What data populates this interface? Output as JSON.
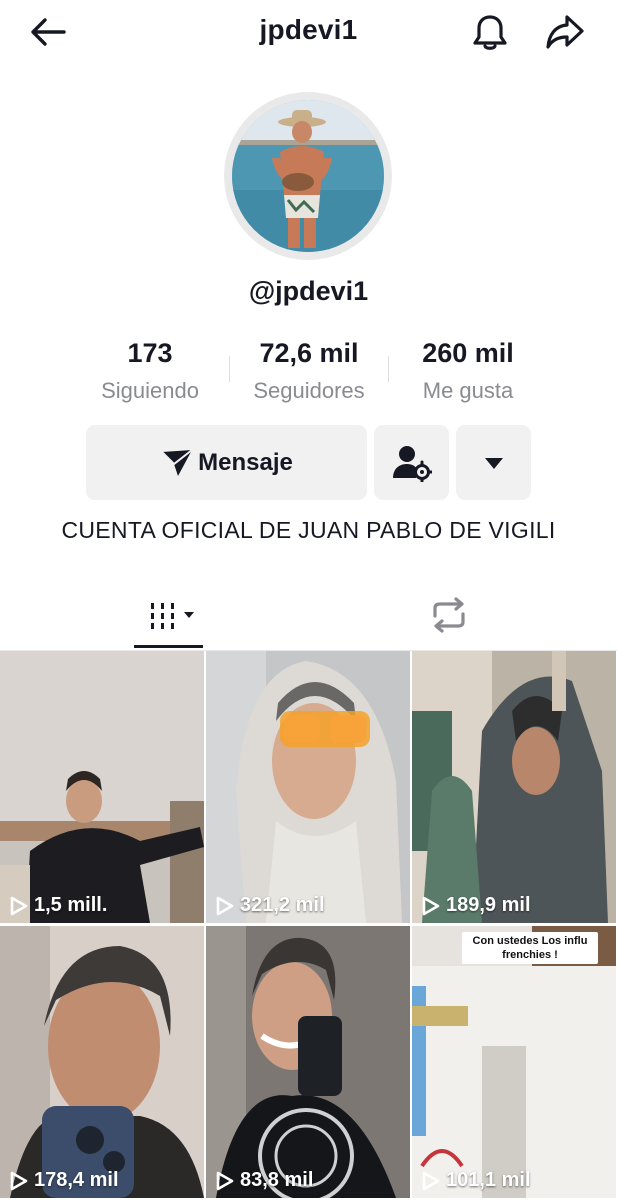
{
  "header": {
    "title": "jpdevi1",
    "back_icon": "arrow-left-icon",
    "bell_icon": "bell-icon",
    "share_icon": "share-arrow-icon"
  },
  "profile": {
    "handle": "@jpdevi1",
    "avatar_icon": "profile-photo",
    "stats": [
      {
        "value": "173",
        "label": "Siguiendo"
      },
      {
        "value": "72,6 mil",
        "label": "Seguidores"
      },
      {
        "value": "260 mil",
        "label": "Me gusta"
      }
    ],
    "message_button": {
      "label": "Mensaje",
      "icon": "send-icon"
    },
    "add_friend_icon": "user-settings-icon",
    "more_icon": "caret-down-icon",
    "bio": "CUENTA OFICIAL DE JUAN PABLO DE VIGILI"
  },
  "tabs": [
    {
      "name": "videos",
      "icon": "grid-lines-icon",
      "active": true
    },
    {
      "name": "reposts",
      "icon": "repost-icon",
      "active": false
    }
  ],
  "videos": [
    {
      "views": "1,5 mill."
    },
    {
      "views": "321,2 mil"
    },
    {
      "views": "189,9 mil"
    },
    {
      "views": "178,4 mil"
    },
    {
      "views": "83,8 mil"
    },
    {
      "views": "101,1 mil",
      "caption": "Con ustedes Los influ frenchies !"
    }
  ],
  "colors": {
    "text": "#161823",
    "secondary": "#8a8b91",
    "button_bg": "#f1f1f2"
  }
}
